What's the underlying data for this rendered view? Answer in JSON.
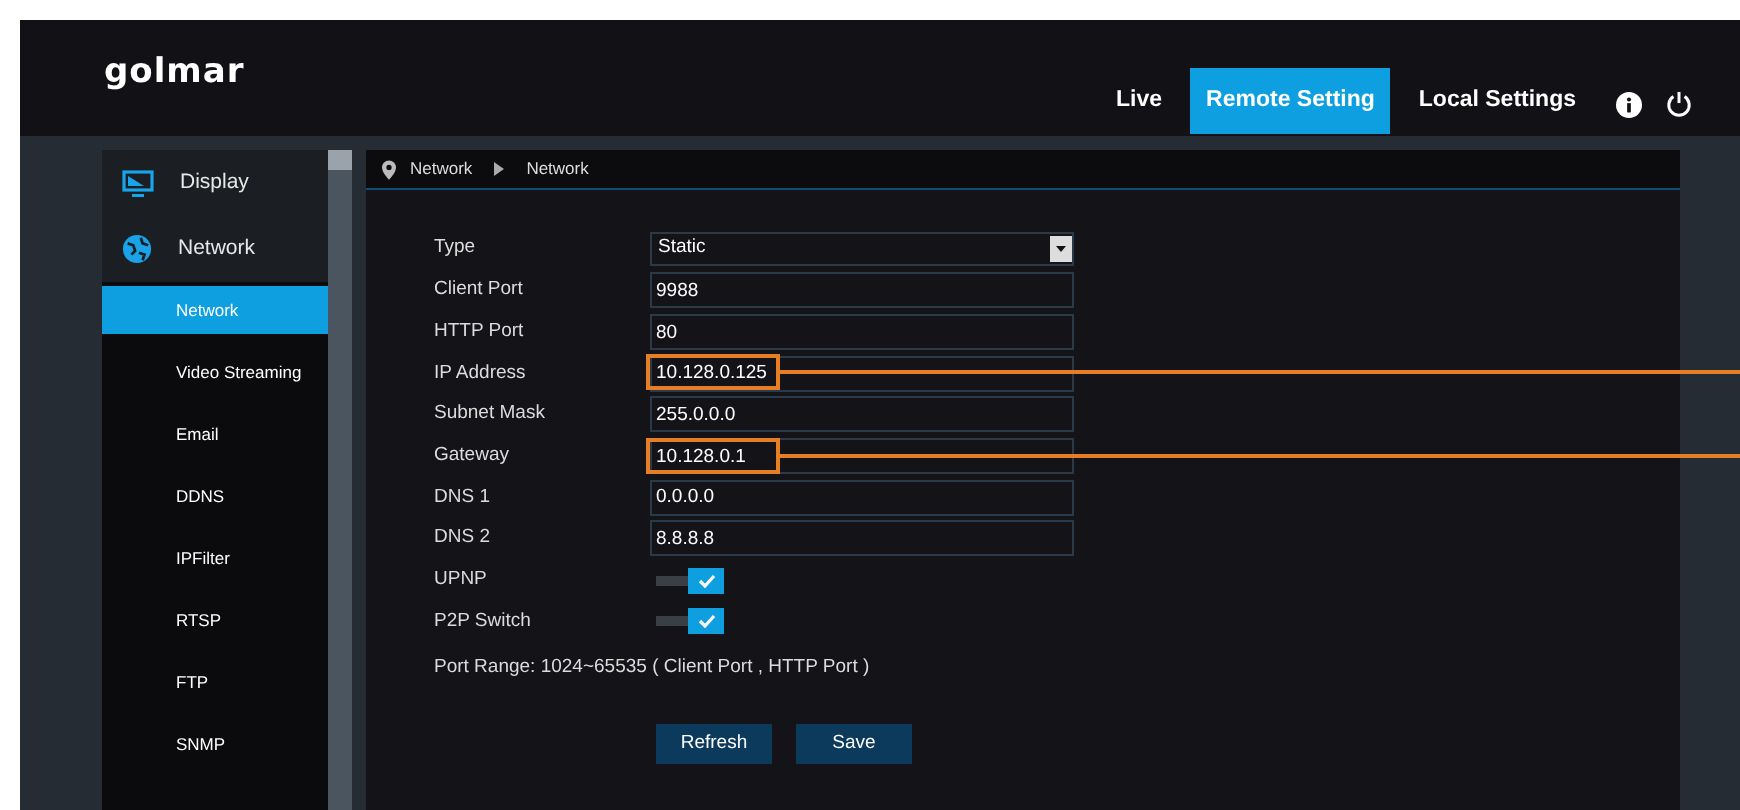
{
  "header": {
    "logo": "golmar",
    "nav": [
      {
        "label": "Live",
        "selected": false
      },
      {
        "label": "Remote Setting",
        "selected": true
      },
      {
        "label": "Local Settings",
        "selected": false
      }
    ]
  },
  "sidebar": {
    "groups": [
      {
        "label": "Display"
      },
      {
        "label": "Network",
        "children": [
          {
            "label": "Network",
            "selected": true
          },
          {
            "label": "Video Streaming",
            "selected": false
          },
          {
            "label": "Email",
            "selected": false
          },
          {
            "label": "DDNS",
            "selected": false
          },
          {
            "label": "IPFilter",
            "selected": false
          },
          {
            "label": "RTSP",
            "selected": false
          },
          {
            "label": "FTP",
            "selected": false
          },
          {
            "label": "SNMP",
            "selected": false
          }
        ]
      }
    ]
  },
  "breadcrumb": [
    "Network",
    "Network"
  ],
  "form": {
    "fields": [
      {
        "kind": "select",
        "label": "Type",
        "value": "Static"
      },
      {
        "kind": "text",
        "label": "Client Port",
        "value": "9988"
      },
      {
        "kind": "text",
        "label": "HTTP Port",
        "value": "80"
      },
      {
        "kind": "text",
        "label": "IP Address",
        "value": "10.128.0.125",
        "highlighted": true
      },
      {
        "kind": "text",
        "label": "Subnet Mask",
        "value": "255.0.0.0"
      },
      {
        "kind": "text",
        "label": "Gateway",
        "value": "10.128.0.1",
        "highlighted": true
      },
      {
        "kind": "text",
        "label": "DNS 1",
        "value": "0.0.0.0"
      },
      {
        "kind": "text",
        "label": "DNS 2",
        "value": "8.8.8.8"
      },
      {
        "kind": "toggle",
        "label": "UPNP",
        "on": true
      },
      {
        "kind": "toggle",
        "label": "P2P Switch",
        "on": true
      }
    ],
    "note": "Port Range: 1024~65535 ( Client Port , HTTP Port )",
    "buttons": [
      "Refresh",
      "Save"
    ]
  }
}
